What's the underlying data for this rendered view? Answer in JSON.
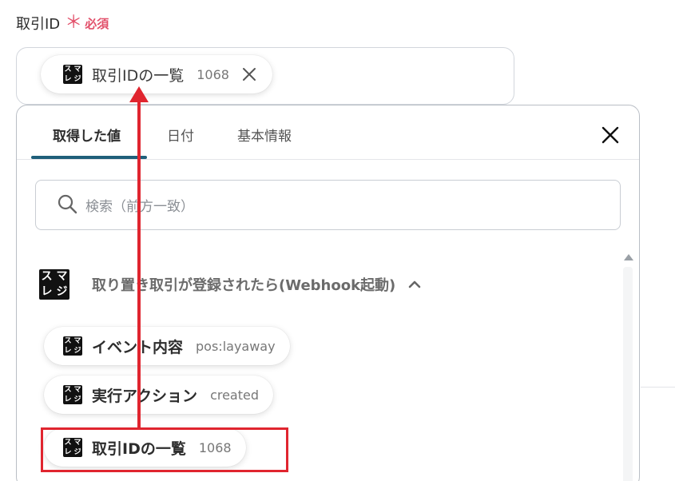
{
  "field": {
    "label": "取引ID",
    "required_mark": "＊",
    "required_text": "必須",
    "selected_chip": {
      "logo": [
        "ス",
        "マ",
        "レ",
        "ジ"
      ],
      "label": "取引IDの一覧",
      "value": "1068"
    }
  },
  "tabs": [
    {
      "label": "取得した値",
      "active": true
    },
    {
      "label": "日付",
      "active": false
    },
    {
      "label": "基本情報",
      "active": false
    }
  ],
  "search": {
    "placeholder": "検索（前方一致）"
  },
  "section": {
    "title": "取り置き取引が登録されたら(Webhook起動)",
    "logo": [
      "ス",
      "マ",
      "レ",
      "ジ"
    ],
    "items": [
      {
        "label": "イベント内容",
        "value": "pos:layaway"
      },
      {
        "label": "実行アクション",
        "value": "created"
      },
      {
        "label": "取引IDの一覧",
        "value": "1068"
      }
    ]
  },
  "colors": {
    "required": "#e2506a",
    "tab_underline": "#1f5f7a",
    "annotation": "#e0252f"
  },
  "icons": [
    "smaregi-logo-icon",
    "close-icon",
    "search-icon",
    "chevron-up-icon",
    "scroll-up-arrow-icon"
  ]
}
